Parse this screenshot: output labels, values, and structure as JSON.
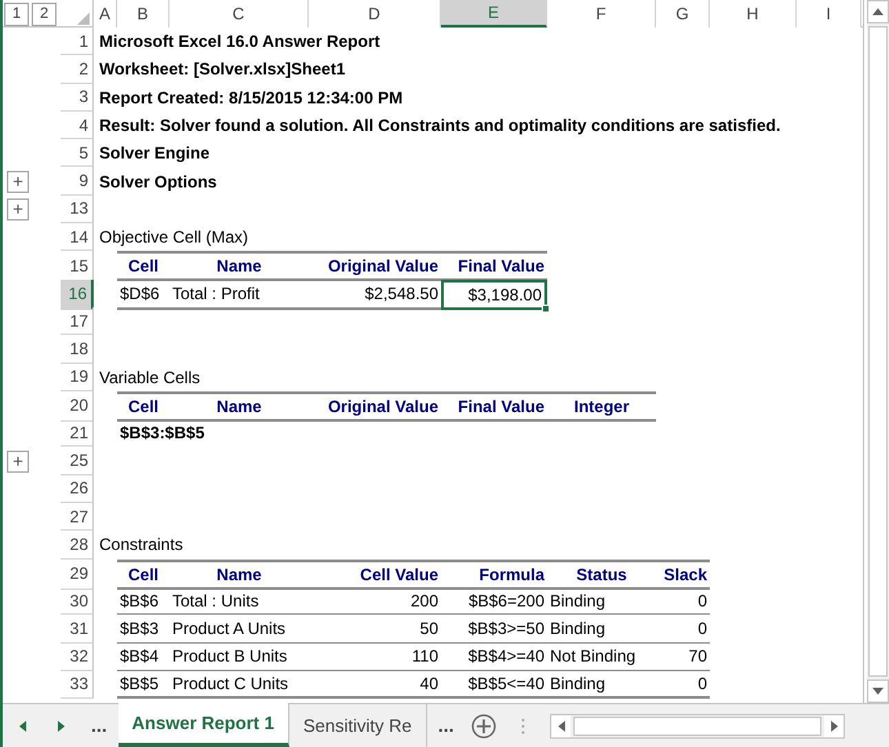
{
  "outline_levels": [
    "1",
    "2"
  ],
  "columns": [
    {
      "label": "A",
      "selected": false
    },
    {
      "label": "B",
      "selected": false
    },
    {
      "label": "C",
      "selected": false
    },
    {
      "label": "D",
      "selected": false
    },
    {
      "label": "E",
      "selected": true
    },
    {
      "label": "F",
      "selected": false
    },
    {
      "label": "G",
      "selected": false
    },
    {
      "label": "H",
      "selected": false
    },
    {
      "label": "I",
      "selected": false
    }
  ],
  "rows": [
    {
      "number": "1",
      "selected": false,
      "kind": "title",
      "text": "Microsoft Excel 16.0 Answer Report"
    },
    {
      "number": "2",
      "selected": false,
      "kind": "title",
      "text": "Worksheet: [Solver.xlsx]Sheet1"
    },
    {
      "number": "3",
      "selected": false,
      "kind": "title",
      "text": "Report Created: 8/15/2015 12:34:00 PM"
    },
    {
      "number": "4",
      "selected": false,
      "kind": "title",
      "text": "Result: Solver found a solution.  All Constraints and optimality conditions are satisfied."
    },
    {
      "number": "5",
      "selected": false,
      "kind": "title",
      "text": "Solver Engine"
    },
    {
      "number": "9",
      "selected": false,
      "kind": "title",
      "text": "Solver Options",
      "expand_button": "+"
    },
    {
      "number": "13",
      "selected": false,
      "kind": "blank",
      "expand_button": "+"
    },
    {
      "number": "14",
      "selected": false,
      "kind": "caption",
      "text": "Objective Cell (Max)"
    },
    {
      "number": "15",
      "selected": false,
      "kind": "header",
      "cells": [
        "Cell",
        "Name",
        "Original Value",
        "Final Value"
      ]
    },
    {
      "number": "16",
      "selected": true,
      "kind": "data",
      "cells": [
        {
          "text": "$D$6",
          "selected": false
        },
        {
          "text": "Total : Profit",
          "selected": false
        },
        {
          "text": "$2,548.50",
          "selected": false
        },
        {
          "text": "$3,198.00",
          "selected": true
        }
      ]
    },
    {
      "number": "17",
      "selected": false,
      "kind": "blank"
    },
    {
      "number": "18",
      "selected": false,
      "kind": "blank"
    },
    {
      "number": "19",
      "selected": false,
      "kind": "caption",
      "text": "Variable Cells"
    },
    {
      "number": "20",
      "selected": false,
      "kind": "header",
      "cells": [
        "Cell",
        "Name",
        "Original Value",
        "Final Value",
        "Integer"
      ]
    },
    {
      "number": "21",
      "selected": false,
      "kind": "range",
      "text": "$B$3:$B$5"
    },
    {
      "number": "25",
      "selected": false,
      "kind": "blank",
      "expand_button": "+"
    },
    {
      "number": "26",
      "selected": false,
      "kind": "blank"
    },
    {
      "number": "27",
      "selected": false,
      "kind": "blank"
    },
    {
      "number": "28",
      "selected": false,
      "kind": "caption",
      "text": "Constraints"
    },
    {
      "number": "29",
      "selected": false,
      "kind": "header",
      "cells": [
        "Cell",
        "Name",
        "Cell Value",
        "Formula",
        "Status",
        "Slack"
      ]
    },
    {
      "number": "30",
      "selected": false,
      "kind": "data",
      "cells": [
        {
          "text": "$B$6",
          "selected": false
        },
        {
          "text": "Total : Units",
          "selected": false
        },
        {
          "text": "200",
          "selected": false
        },
        {
          "text": "$B$6=200",
          "selected": false
        },
        {
          "text": "Binding",
          "selected": false
        },
        {
          "text": "0",
          "selected": false
        }
      ]
    },
    {
      "number": "31",
      "selected": false,
      "kind": "data",
      "cells": [
        {
          "text": "$B$3",
          "selected": false
        },
        {
          "text": "Product A Units",
          "selected": false
        },
        {
          "text": "50",
          "selected": false
        },
        {
          "text": "$B$3>=50",
          "selected": false
        },
        {
          "text": "Binding",
          "selected": false
        },
        {
          "text": "0",
          "selected": false
        }
      ]
    },
    {
      "number": "32",
      "selected": false,
      "kind": "data",
      "cells": [
        {
          "text": "$B$4",
          "selected": false
        },
        {
          "text": "Product B Units",
          "selected": false
        },
        {
          "text": "110",
          "selected": false
        },
        {
          "text": "$B$4>=40",
          "selected": false
        },
        {
          "text": "Not Binding",
          "selected": false
        },
        {
          "text": "70",
          "selected": false
        }
      ]
    },
    {
      "number": "33",
      "selected": false,
      "kind": "data",
      "cells": [
        {
          "text": "$B$5",
          "selected": false
        },
        {
          "text": "Product C Units",
          "selected": false
        },
        {
          "text": "40",
          "selected": false
        },
        {
          "text": "$B$5<=40",
          "selected": false
        },
        {
          "text": "Binding",
          "selected": false
        },
        {
          "text": "0",
          "selected": false
        }
      ]
    }
  ],
  "tab_bar": {
    "more_left": "...",
    "more_right": "...",
    "tabs": [
      {
        "label": "Answer Report 1",
        "selected": true
      },
      {
        "label": "Sensitivity Re",
        "selected": false
      }
    ]
  }
}
